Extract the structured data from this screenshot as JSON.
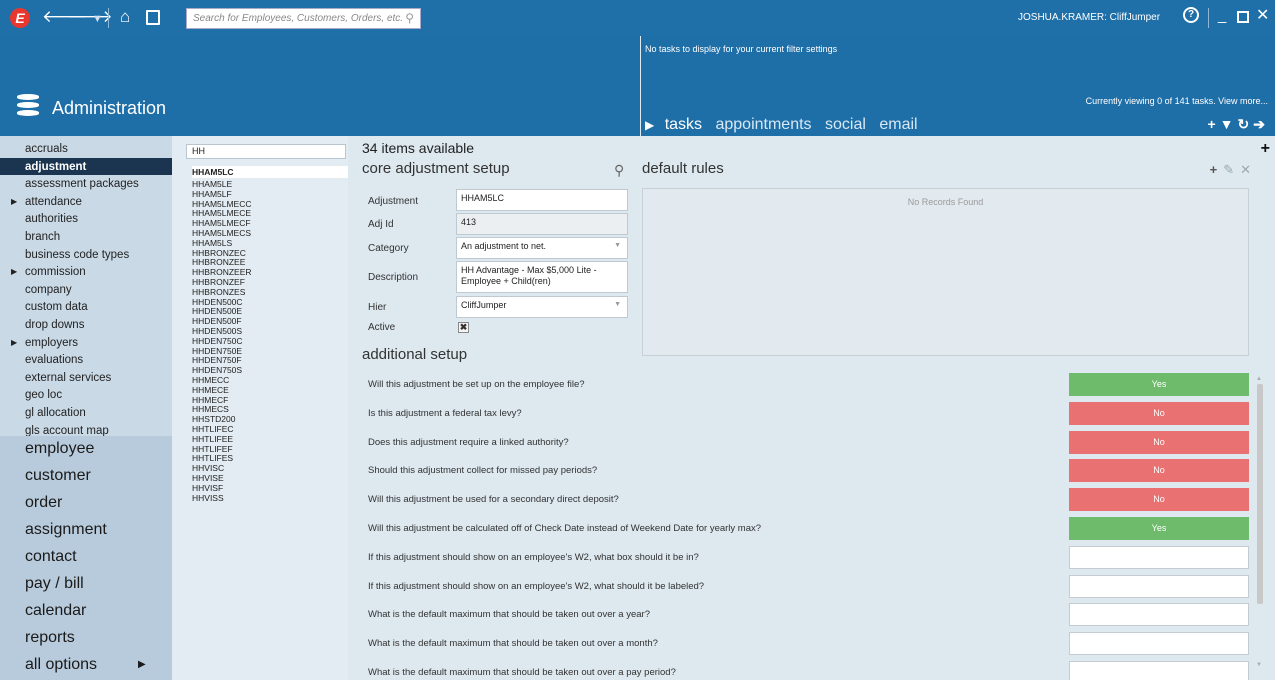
{
  "topbar": {
    "logo": "E",
    "search_placeholder": "Search for Employees, Customers, Orders, etc.",
    "user": "JOSHUA.KRAMER: CliffJumper"
  },
  "header": {
    "section_title": "Administration",
    "no_tasks": "No tasks to display for your current filter settings",
    "viewing": "Currently viewing 0 of 141 tasks. View more...",
    "tabs": [
      "tasks",
      "appointments",
      "social",
      "email"
    ]
  },
  "nav": {
    "items": [
      {
        "label": "accruals",
        "caret": false,
        "active": false
      },
      {
        "label": "adjustment",
        "caret": false,
        "active": true
      },
      {
        "label": "assessment packages",
        "caret": false,
        "active": false
      },
      {
        "label": "attendance",
        "caret": true,
        "active": false
      },
      {
        "label": "authorities",
        "caret": false,
        "active": false
      },
      {
        "label": "branch",
        "caret": false,
        "active": false
      },
      {
        "label": "business code types",
        "caret": false,
        "active": false
      },
      {
        "label": "commission",
        "caret": true,
        "active": false
      },
      {
        "label": "company",
        "caret": false,
        "active": false
      },
      {
        "label": "custom data",
        "caret": false,
        "active": false
      },
      {
        "label": "drop downs",
        "caret": false,
        "active": false
      },
      {
        "label": "employers",
        "caret": true,
        "active": false
      },
      {
        "label": "evaluations",
        "caret": false,
        "active": false
      },
      {
        "label": "external services",
        "caret": false,
        "active": false
      },
      {
        "label": "geo loc",
        "caret": false,
        "active": false
      },
      {
        "label": "gl allocation",
        "caret": false,
        "active": false
      },
      {
        "label": "gls account map",
        "caret": false,
        "active": false
      }
    ],
    "main": [
      "employee",
      "customer",
      "order",
      "assignment",
      "contact",
      "pay / bill",
      "calendar",
      "reports",
      "all options"
    ]
  },
  "list": {
    "filter_value": "HH",
    "items": [
      "HHAM5LC",
      "HHAM5LE",
      "HHAM5LF",
      "HHAM5LMECC",
      "HHAM5LMECE",
      "HHAM5LMECF",
      "HHAM5LMECS",
      "HHAM5LS",
      "HHBRONZEC",
      "HHBRONZEE",
      "HHBRONZEER",
      "HHBRONZEF",
      "HHBRONZES",
      "HHDEN500C",
      "HHDEN500E",
      "HHDEN500F",
      "HHDEN500S",
      "HHDEN750C",
      "HHDEN750E",
      "HHDEN750F",
      "HHDEN750S",
      "HHMECC",
      "HHMECE",
      "HHMECF",
      "HHMECS",
      "HHSTD200",
      "HHTLIFEC",
      "HHTLIFEE",
      "HHTLIFEF",
      "HHTLIFES",
      "HHVISC",
      "HHVISE",
      "HHVISF",
      "HHVISS"
    ]
  },
  "main": {
    "items_count": "34 items available",
    "core_title": "core adjustment setup",
    "rules_title": "default rules",
    "no_records": "No Records Found",
    "additional_title": "additional setup",
    "form": {
      "adjustment_label": "Adjustment",
      "adjustment_value": "HHAM5LC",
      "adjid_label": "Adj Id",
      "adjid_value": "413",
      "category_label": "Category",
      "category_value": "An adjustment to net.",
      "description_label": "Description",
      "description_value": "HH Advantage - Max $5,000 Lite - Employee + Child(ren)",
      "hier_label": "Hier",
      "hier_value": "CliffJumper",
      "active_label": "Active",
      "active_mark": "✖"
    },
    "questions": [
      {
        "text": "Will this adjustment be set up on the employee file?",
        "answer": "Yes"
      },
      {
        "text": "Is this adjustment a federal tax levy?",
        "answer": "No"
      },
      {
        "text": "Does this adjustment require a linked authority?",
        "answer": "No"
      },
      {
        "text": "Should this adjustment collect for missed pay periods?",
        "answer": "No"
      },
      {
        "text": "Will this adjustment be used for a secondary direct deposit?",
        "answer": "No"
      },
      {
        "text": "Will this adjustment be calculated off of Check Date instead of Weekend Date for yearly max?",
        "answer": "Yes"
      },
      {
        "text": "If this adjustment should show on an employee's W2, what box should it be in?",
        "answer": ""
      },
      {
        "text": "If this adjustment should show on an employee's W2, what should it be labeled?",
        "answer": ""
      },
      {
        "text": "What is the default maximum that should be taken out over a year?",
        "answer": ""
      },
      {
        "text": "What is the default maximum that should be taken out over a month?",
        "answer": ""
      },
      {
        "text": "What is the default maximum that should be taken out over a pay period?",
        "answer": ""
      }
    ]
  },
  "colors": {
    "header_blue": "#1e6ea7",
    "yes_green": "#6dbb6b",
    "no_red": "#e97171",
    "active_nav": "#1b3550"
  }
}
